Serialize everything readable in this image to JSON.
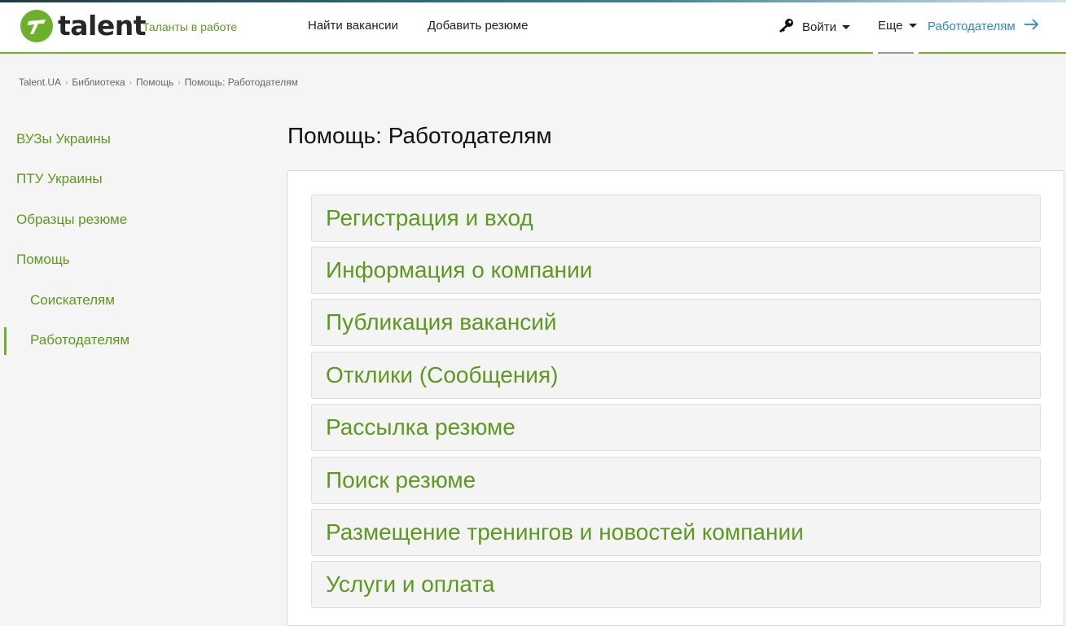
{
  "header": {
    "logo_text": "talent",
    "tagline": "Таланты в работе",
    "nav": {
      "find_jobs": "Найти вакансии",
      "add_resume": "Добавить резюме"
    },
    "login_label": "Войти",
    "more_label": "Еще",
    "employers_label": "Работодателям"
  },
  "breadcrumb": {
    "items": [
      "Talent.UA",
      "Библиотека",
      "Помощь",
      "Помощь: Работодателям"
    ],
    "separator": "›"
  },
  "sidebar": {
    "items": [
      {
        "label": "ВУЗы Украины"
      },
      {
        "label": "ПТУ Украины"
      },
      {
        "label": "Образцы резюме"
      },
      {
        "label": "Помощь"
      },
      {
        "label": "Соискателям"
      },
      {
        "label": "Работодателям"
      }
    ]
  },
  "main": {
    "title": "Помощь: Работодателям",
    "sections": [
      {
        "label": "Регистрация и вход"
      },
      {
        "label": "Информация о компании"
      },
      {
        "label": "Публикация вакансий"
      },
      {
        "label": "Отклики (Сообщения)"
      },
      {
        "label": "Рассылка резюме"
      },
      {
        "label": "Поиск резюме"
      },
      {
        "label": "Размещение тренингов и новостей компании"
      },
      {
        "label": "Услуги и оплата"
      }
    ]
  },
  "colors": {
    "brand_green": "#6db02b",
    "link_green": "#5c9a1f",
    "link_blue": "#2a8ac9"
  }
}
